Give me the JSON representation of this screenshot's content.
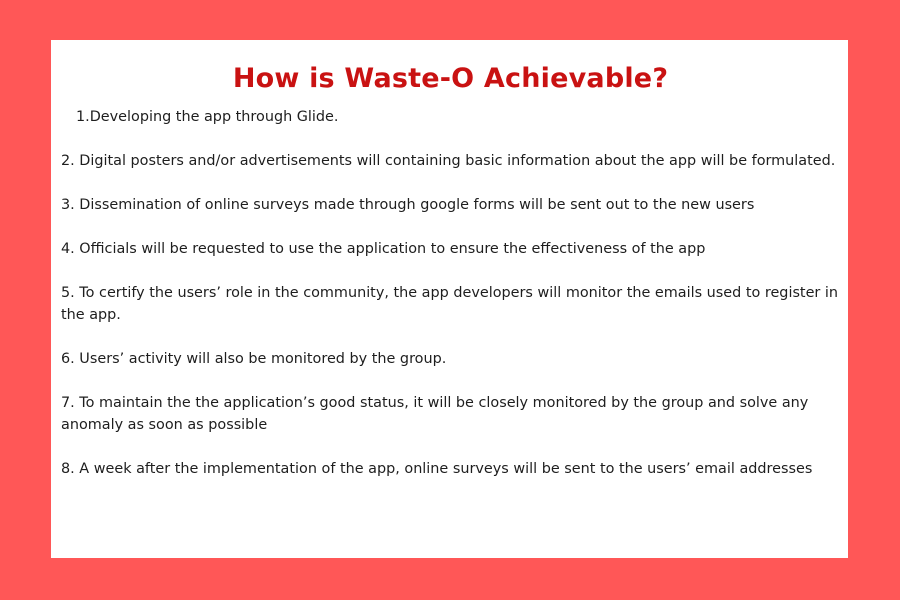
{
  "title": "How is Waste-O Achievable?",
  "steps": [
    "1.Developing the app through Glide.",
    "2. Digital posters and/or advertisements will containing basic information about the app will be formulated.",
    "3. Dissemination of online surveys made through google forms will be sent out to the new users",
    "4. Officials will be requested to use the application to ensure the effectiveness of the app",
    "5. To certify the users’ role in the community, the app developers will monitor the emails used to register in the app.",
    "6. Users’ activity will also be monitored by the group.",
    "7. To maintain the the application’s good status, it will be closely monitored by the group and solve any anomaly as soon as possible",
    "8. A week after the implementation of the app, online surveys will be sent to the users’ email addresses"
  ],
  "colors": {
    "background": "#ff5757",
    "card": "#ffffff",
    "title": "#c91212",
    "text": "#1e1e1e"
  }
}
